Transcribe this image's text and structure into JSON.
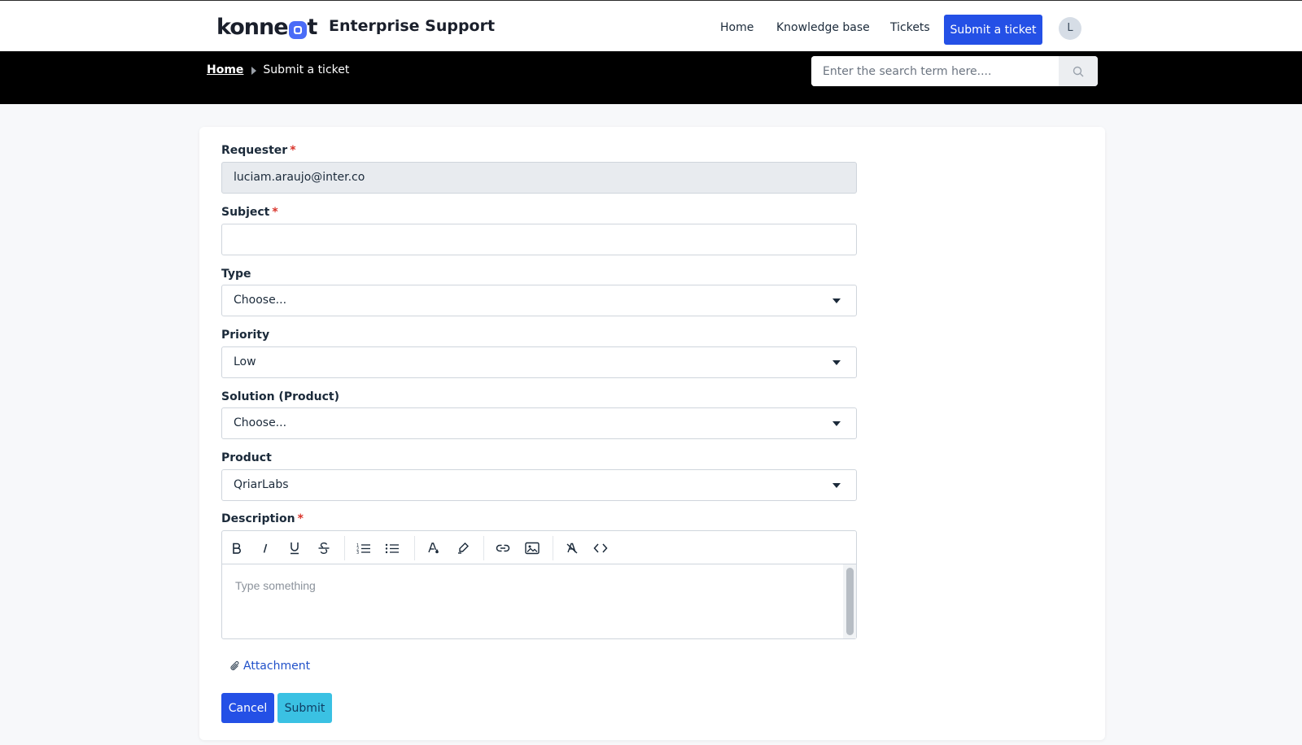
{
  "header": {
    "logo_prefix": "konne",
    "logo_suffix": "t",
    "brand_subtitle": "Enterprise Support",
    "nav": {
      "home": "Home",
      "knowledge_base": "Knowledge base",
      "tickets": "Tickets"
    },
    "submit_ticket_label": "Submit a ticket",
    "avatar_initial": "L",
    "brand_color": "#2450e6"
  },
  "breadcrumb": {
    "home": "Home",
    "current": "Submit a ticket"
  },
  "search": {
    "placeholder": "Enter the search term here...."
  },
  "form": {
    "requester": {
      "label": "Requester",
      "value": "luciam.araujo@inter.co",
      "required": true
    },
    "subject": {
      "label": "Subject",
      "value": "",
      "required": true
    },
    "type": {
      "label": "Type",
      "selected": "Choose..."
    },
    "priority": {
      "label": "Priority",
      "selected": "Low"
    },
    "solution": {
      "label": "Solution (Product)",
      "selected": "Choose..."
    },
    "product": {
      "label": "Product",
      "selected": "QriarLabs"
    },
    "description": {
      "label": "Description",
      "placeholder": "Type something",
      "required": true
    },
    "required_marker": "*",
    "attachment_label": "Attachment",
    "cancel_label": "Cancel",
    "submit_label": "Submit"
  },
  "editor_toolbar": [
    "bold-icon",
    "italic-icon",
    "underline-icon",
    "strikethrough-icon",
    "ordered-list-icon",
    "bullet-list-icon",
    "text-color-icon",
    "highlight-icon",
    "link-icon",
    "image-icon",
    "clear-format-icon",
    "code-icon"
  ]
}
